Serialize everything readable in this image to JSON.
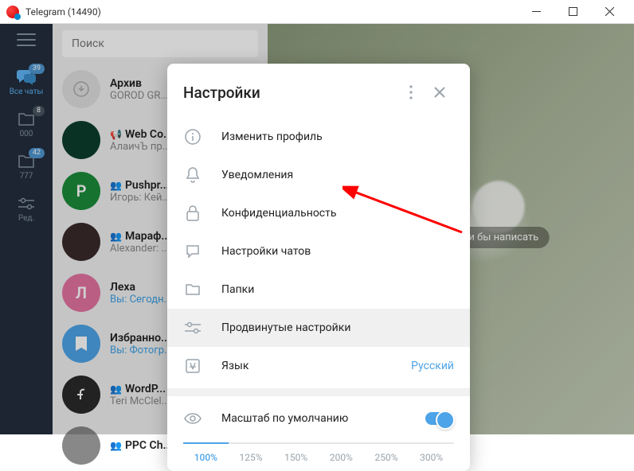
{
  "window": {
    "title": "Telegram (14490)"
  },
  "search": {
    "placeholder": "Поиск"
  },
  "rail": {
    "items": [
      {
        "label": "Все чаты",
        "badge": "39"
      },
      {
        "label": "000",
        "badge": "8"
      },
      {
        "label": "777",
        "badge": "42"
      },
      {
        "label": "Ред.",
        "badge": ""
      }
    ]
  },
  "archive": {
    "title": "Архив",
    "subtitle": "GOROD GR..."
  },
  "chats": [
    {
      "name": "Web Co...",
      "sub": "АлаичЪ пр...",
      "group": true,
      "avatar_bg": "#0b3d2e",
      "avatar_text": ""
    },
    {
      "name": "Pushpr...",
      "sub": "Игорь: Кей...",
      "group": true,
      "avatar_bg": "#1a8b3a",
      "avatar_text": "P"
    },
    {
      "name": "Мараф...",
      "sub": "Alexander: ...",
      "group": true,
      "avatar_bg": "#3a2a2a",
      "avatar_text": ""
    },
    {
      "name": "Леха",
      "sub_you": "Вы:",
      "sub": " Сегодн...",
      "group": false,
      "avatar_bg": "#e573a0",
      "avatar_text": "Л"
    },
    {
      "name": "Избранно...",
      "sub_you": "Вы:",
      "sub": " Фотогр...",
      "group": false,
      "avatar_bg": "#4ea4e8",
      "avatar_text": ""
    },
    {
      "name": "WordP...",
      "sub": "Teri McClel...",
      "group": true,
      "avatar_bg": "#2a2a2a",
      "avatar_text": ""
    },
    {
      "name": "PPC Ch...",
      "sub": "",
      "group": true,
      "avatar_bg": "#888",
      "avatar_text": ""
    }
  ],
  "convo": {
    "hint": "Выберите, кому хотели бы написать"
  },
  "modal": {
    "title": "Настройки",
    "items": {
      "profile": "Изменить профиль",
      "notifications": "Уведомления",
      "privacy": "Конфиденциальность",
      "chat_settings": "Настройки чатов",
      "folders": "Папки",
      "advanced": "Продвинутые настройки",
      "language": "Язык",
      "language_value": "Русский",
      "scale": "Масштаб по умолчанию"
    },
    "scale_options": [
      "100%",
      "125%",
      "150%",
      "200%",
      "250%",
      "300%"
    ]
  }
}
